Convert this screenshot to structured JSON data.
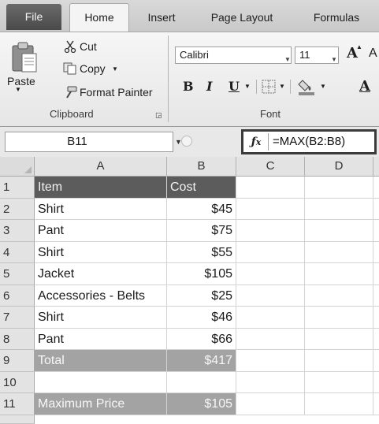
{
  "ribbon": {
    "tabs": {
      "file": "File",
      "home": "Home",
      "insert": "Insert",
      "page_layout": "Page Layout",
      "formulas": "Formulas"
    },
    "clipboard": {
      "paste": "Paste",
      "cut": "Cut",
      "copy": "Copy",
      "format_painter": "Format Painter",
      "group_label": "Clipboard"
    },
    "font": {
      "family": "Calibri",
      "size": "11",
      "bold": "B",
      "italic": "I",
      "underline": "U",
      "grow": "A",
      "color": "A",
      "group_label": "Font"
    }
  },
  "formula_bar": {
    "name_box": "B11",
    "fx": "fx",
    "formula": "=MAX(B2:B8)"
  },
  "sheet": {
    "columns": [
      "A",
      "B",
      "C",
      "D"
    ],
    "rows": [
      {
        "num": "1",
        "a": "Item",
        "b": "Cost"
      },
      {
        "num": "2",
        "a": "Shirt",
        "b": "$45"
      },
      {
        "num": "3",
        "a": "Pant",
        "b": "$75"
      },
      {
        "num": "4",
        "a": "Shirt",
        "b": "$55"
      },
      {
        "num": "5",
        "a": "Jacket",
        "b": "$105"
      },
      {
        "num": "6",
        "a": "Accessories - Belts",
        "b": "$25"
      },
      {
        "num": "7",
        "a": "Shirt",
        "b": "$46"
      },
      {
        "num": "8",
        "a": "Pant",
        "b": "$66"
      },
      {
        "num": "9",
        "a": "Total",
        "b": "$417"
      },
      {
        "num": "10",
        "a": "",
        "b": ""
      },
      {
        "num": "11",
        "a": "Maximum Price",
        "b": "$105"
      }
    ]
  }
}
